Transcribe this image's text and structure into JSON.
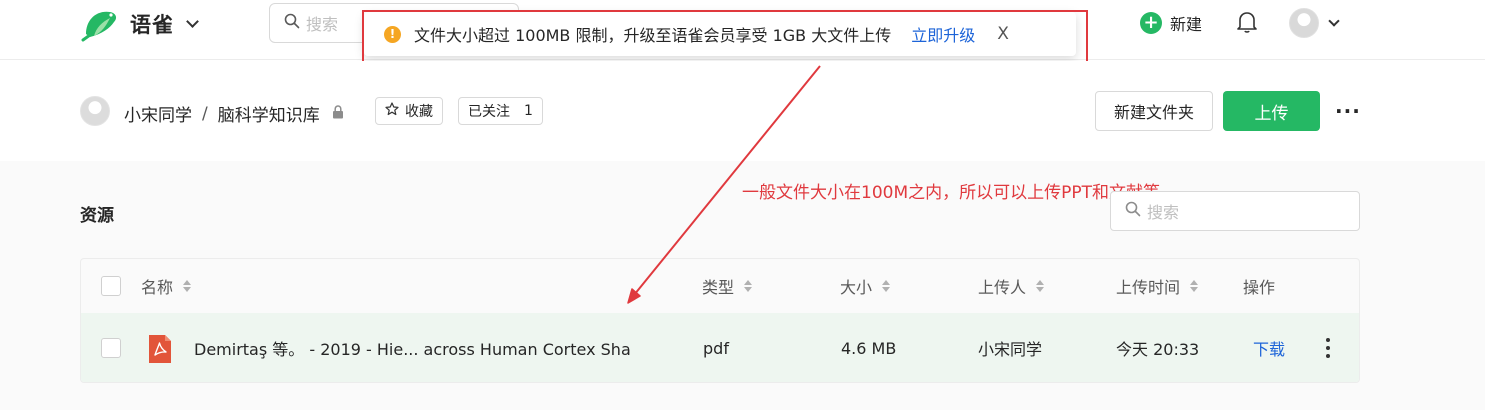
{
  "app": {
    "name": "语雀"
  },
  "topbar": {
    "search_placeholder": "搜索",
    "new_label": "新建"
  },
  "toast": {
    "message": "文件大小超过 100MB 限制，升级至语雀会员享受 1GB 大文件上传",
    "action": "立即升级",
    "close": "X"
  },
  "breadcrumb": {
    "user": "小宋同学",
    "separator": "/",
    "repo": "脑科学知识库"
  },
  "actions": {
    "favorite": "收藏",
    "followed": "已关注",
    "follow_count": "1",
    "new_folder": "新建文件夹",
    "upload": "上传"
  },
  "resources": {
    "title": "资源",
    "search_placeholder": "搜索",
    "columns": [
      "名称",
      "类型",
      "大小",
      "上传人",
      "上传时间",
      "操作"
    ],
    "rows": [
      {
        "name": "Demirtaş 等。 - 2019 - Hie... across Human Cortex Sha",
        "type": "pdf",
        "size": "4.6 MB",
        "uploader": "小宋同学",
        "time": "今天 20:33",
        "action": "下载"
      }
    ]
  },
  "annotation": {
    "text": "一般文件大小在100M之内，所以可以上传PPT和文献等",
    "color": "#e0393e"
  },
  "colors": {
    "brand_green": "#25b864",
    "link_blue": "#1d64d8",
    "warning": "#f5a623",
    "annotation_red": "#e0393e"
  }
}
